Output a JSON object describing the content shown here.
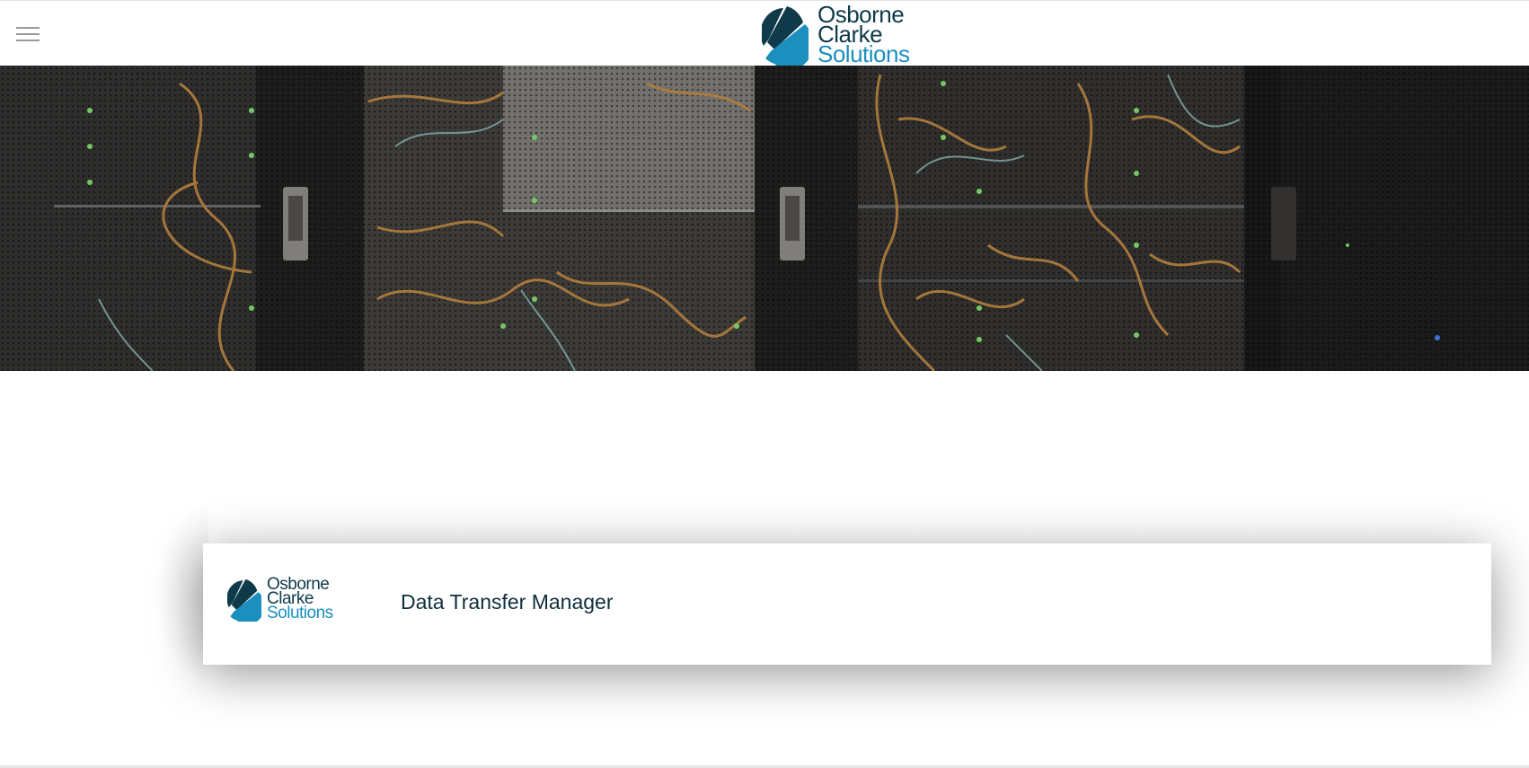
{
  "header": {
    "logo": {
      "line1": "Osborne",
      "line2": "Clarke",
      "line3": "Solutions",
      "icon": "osborne-clarke-mark-icon"
    },
    "menu_icon": "hamburger-menu-icon"
  },
  "hero": {
    "image": "server-rack-photo"
  },
  "card": {
    "logo": {
      "line1": "Osborne",
      "line2": "Clarke",
      "line3": "Solutions"
    },
    "title": "Data Transfer Manager"
  },
  "colors": {
    "brand_dark": "#0f3a4a",
    "brand_blue": "#1b8fbe",
    "menu_icon": "#9a9a9a"
  }
}
